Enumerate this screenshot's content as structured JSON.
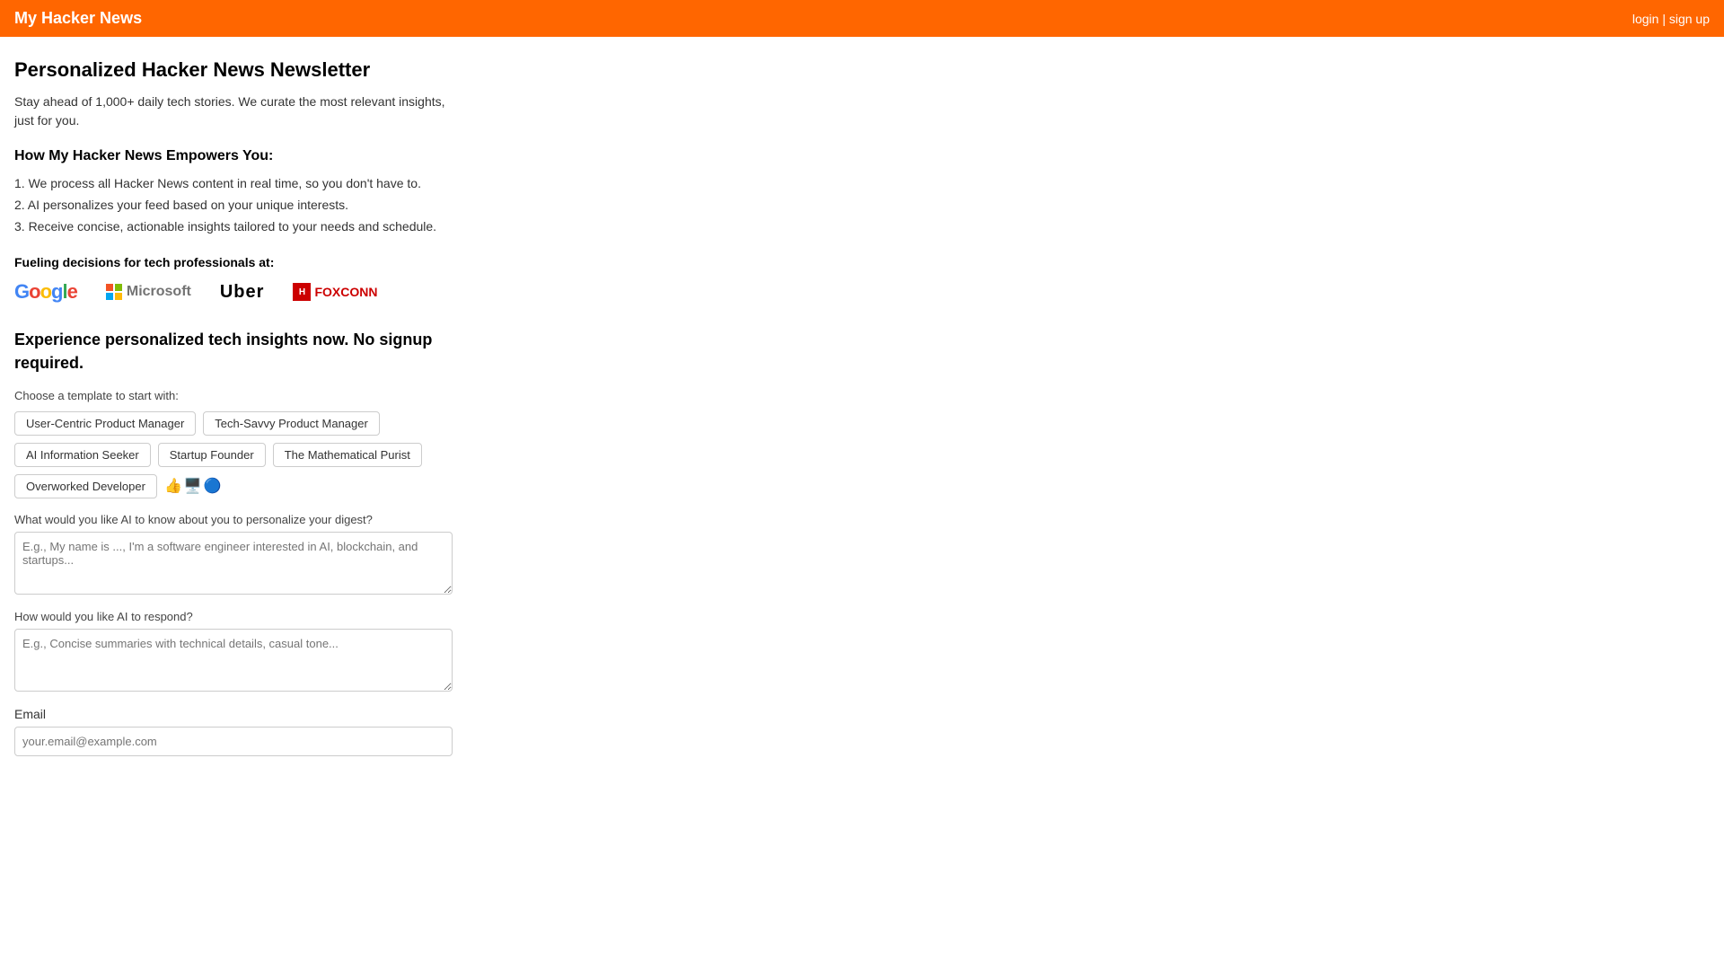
{
  "header": {
    "title": "My Hacker News",
    "login_label": "login",
    "separator": "|",
    "signup_label": "sign up"
  },
  "page": {
    "main_title": "Personalized Hacker News Newsletter",
    "subtitle": "Stay ahead of 1,000+ daily tech stories. We curate the most relevant insights, just for you.",
    "how_title": "How My Hacker News Empowers You:",
    "how_items": [
      "1. We process all Hacker News content in real time, so you don't have to.",
      "2. AI personalizes your feed based on your unique interests.",
      "3. Receive concise, actionable insights tailored to your needs and schedule."
    ],
    "fueling_title": "Fueling decisions for tech professionals at:",
    "cta_title": "Experience personalized tech insights now. No signup required.",
    "choose_label": "Choose a template to start with:",
    "templates": [
      "User-Centric Product Manager",
      "Tech-Savvy Product Manager",
      "AI Information Seeker",
      "Startup Founder",
      "The Mathematical Purist",
      "Overworked Developer"
    ],
    "about_label": "What would you like AI to know about you to personalize your digest?",
    "about_placeholder": "E.g., My name is ..., I'm a software engineer interested in AI, blockchain, and startups...",
    "respond_label": "How would you like AI to respond?",
    "respond_placeholder": "E.g., Concise summaries with technical details, casual tone...",
    "email_label": "Email",
    "email_placeholder": "your.email@example.com"
  },
  "logos": {
    "google": "Google",
    "microsoft": "Microsoft",
    "uber": "Uber",
    "foxconn": "FOXCONN"
  }
}
